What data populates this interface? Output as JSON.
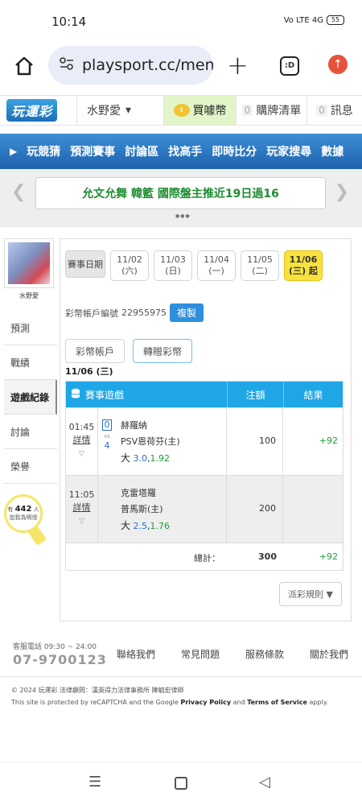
{
  "status": {
    "time": "10:14",
    "signal": "Vo LTE 4G",
    "battery": "55"
  },
  "browser": {
    "url": "playsport.cc/men",
    "tabs_label": ":D"
  },
  "header": {
    "logo": "玩運彩",
    "user": "水野愛",
    "coin_label": "買噱幣",
    "cart_count": "0",
    "cart_label": "購牌清單",
    "msg_count": "0",
    "msg_label": "訊息"
  },
  "nav": {
    "items": [
      "玩競猜",
      "預測賽事",
      "討論區",
      "找高手",
      "即時比分",
      "玩家搜尋",
      "數據"
    ]
  },
  "banner": {
    "part1": "允文允舞",
    "part2": "韓籃",
    "part3": "國際盤主推近19日過16"
  },
  "sidebar": {
    "username": "水野愛",
    "items": [
      "預測",
      "戰績",
      "遊戲紀錄",
      "討論",
      "榮譽"
    ],
    "bulb_pre": "有",
    "bulb_count": "442",
    "bulb_post": "人",
    "bulb_line2": "加我為明燈"
  },
  "dates": {
    "label": "賽事日期",
    "items": [
      {
        "date": "11/02",
        "day": "(六)"
      },
      {
        "date": "11/03",
        "day": "(日)"
      },
      {
        "date": "11/04",
        "day": "(一)"
      },
      {
        "date": "11/05",
        "day": "(二)"
      },
      {
        "date": "11/06",
        "day": "(三) 起"
      }
    ]
  },
  "account": {
    "label": "彩幣帳戶編號",
    "number": "22955975",
    "copy": "複製"
  },
  "buttons": {
    "wallet": "彩幣帳戶",
    "transfer": "轉贈彩幣"
  },
  "day_label": "11/06 (三)",
  "table": {
    "col_game": "賽事遊戲",
    "col_bet": "注額",
    "col_result": "結果",
    "rows": [
      {
        "time": "01:45",
        "detail": "詳情",
        "score_a": "0",
        "score_vs": "vs",
        "score_b": "4",
        "team_a": "赫羅納",
        "team_b": "PSV恩荷芬(主)",
        "pick": "大",
        "line": "3.0",
        "odds": "1.92",
        "bet": "100",
        "result": "+92"
      },
      {
        "time": "11:05",
        "detail": "詳情",
        "team_a": "克雷塔羅",
        "team_b": "普馬斯(主)",
        "pick": "大",
        "line": "2.5",
        "odds": "1.76",
        "bet": "200",
        "result": ""
      }
    ],
    "total_label": "總計：",
    "total_bet": "300",
    "total_result": "+92"
  },
  "rule_btn": "派彩規則 ▼",
  "footer": {
    "svc_label": "客服電話 09:30 ~ 24:00",
    "phone": "07-9700123",
    "links": [
      "聯絡我們",
      "常見問題",
      "服務條款",
      "關於我們"
    ],
    "copyright": "© 2024 玩運彩 法律顧問：漢英得力法律事務所 陳毓宏律師",
    "captcha_pre": "This site is protected by reCAPTCHA and the Google ",
    "privacy": "Privacy Policy",
    "and": " and ",
    "terms": "Terms of Service",
    "apply": " apply."
  }
}
